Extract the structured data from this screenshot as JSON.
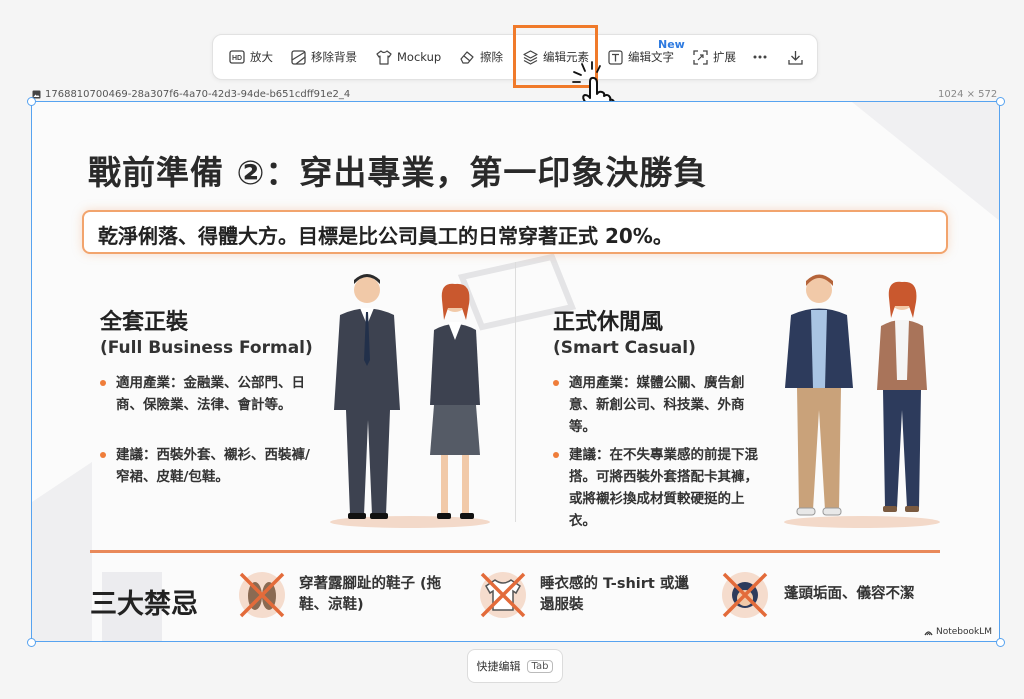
{
  "toolbar": {
    "items": [
      {
        "label": "放大",
        "icon": "hd-icon"
      },
      {
        "label": "移除背景",
        "icon": "remove-bg-icon"
      },
      {
        "label": "Mockup",
        "icon": "tshirt-icon"
      },
      {
        "label": "擦除",
        "icon": "eraser-icon"
      },
      {
        "label": "编辑元素",
        "icon": "layers-icon"
      },
      {
        "label": "编辑文字",
        "icon": "text-edit-icon"
      },
      {
        "label": "扩展",
        "icon": "expand-icon"
      }
    ],
    "new_badge": "New",
    "more_icon": "more-icon",
    "download_icon": "download-icon"
  },
  "file": {
    "name": "1768810700469-28a307f6-4a70-42d3-94de-b651cdff91e2_4",
    "dimensions": "1024 × 572"
  },
  "slide": {
    "title": "戰前準備 ②：穿出專業，第一印象決勝負",
    "subtitle": "乾淨俐落、得體大方。目標是比公司員工的日常穿著正式 20%。",
    "formal": {
      "heading": "全套正裝",
      "subheading": "(Full Business Formal)",
      "bullets": [
        "適用產業：金融業、公部門、日商、保險業、法律、會計等。",
        "建議：西裝外套、襯衫、西裝褲/窄裙、皮鞋/包鞋。"
      ]
    },
    "casual": {
      "heading": "正式休閒風",
      "subheading": "(Smart Casual)",
      "bullets": [
        "適用產業：媒體公關、廣告創意、新創公司、科技業、外商等。",
        "建議：在不失專業感的前提下混搭。可將西裝外套搭配卡其褲，或將襯衫換成材質較硬挺的上衣。"
      ]
    },
    "forbidden": {
      "title": "三大禁忌",
      "items": [
        "穿著露腳趾的鞋子 (拖鞋、涼鞋)",
        "睡衣感的 T-shirt 或邋遢服裝",
        "蓬頭垢面、儀容不潔"
      ]
    },
    "brand": "NotebookLM"
  },
  "bottom": {
    "quick_edit": "快捷编辑",
    "shortcut": "Tab"
  },
  "colors": {
    "accent": "#ef7d3a",
    "selection": "#57a3f0",
    "highlight": "#f07a2a",
    "new_badge": "#2f7be0"
  }
}
